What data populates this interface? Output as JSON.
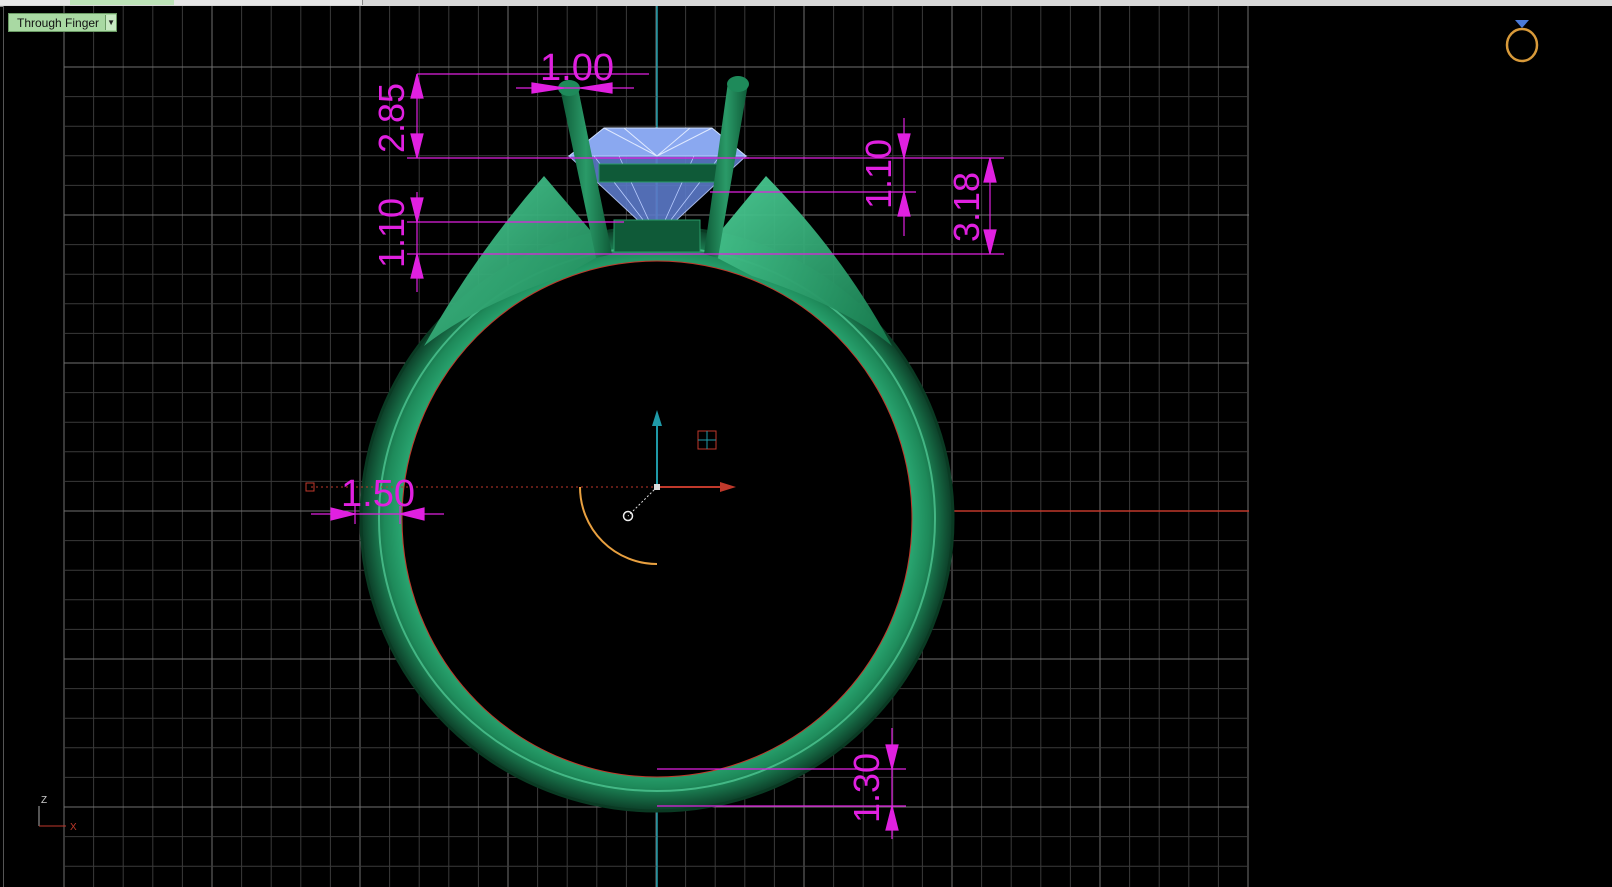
{
  "view_label": "Through Finger",
  "view_dropdown_icon": "chevron-down-icon",
  "dimensions": {
    "prong_width": "1.00",
    "prong_height": "2.85",
    "right_top_small": "1.10",
    "right_total": "3.18",
    "left_mid": "1.10",
    "shank_width": "1.50",
    "bottom_thickness": "1.30"
  },
  "axis_gizmo": {
    "z": "Z",
    "x": "X"
  },
  "colors": {
    "background": "#000000",
    "grid": "#3a3a3a",
    "grid_major": "#707070",
    "ring_metal": "#1e8a5a",
    "dimension": "#e020e0",
    "gem": "#8aa8f0",
    "axis_red": "#c0392b",
    "axis_teal": "#1f9aa8"
  },
  "icons": [
    "ring-icon",
    "axis-gizmo-icon"
  ]
}
